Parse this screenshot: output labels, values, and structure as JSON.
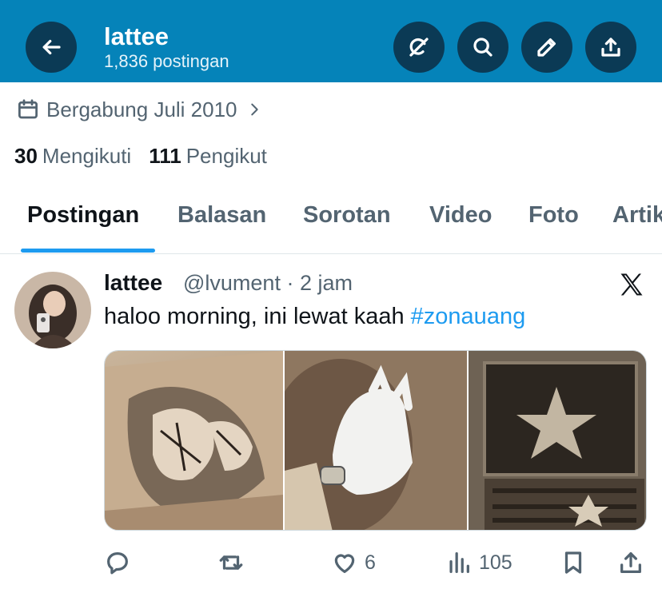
{
  "header": {
    "title": "lattee",
    "subtitle": "1,836 postingan",
    "color": "#0583b9",
    "buttons": [
      {
        "name": "back",
        "icon": "arrow-left-icon"
      },
      {
        "name": "grok",
        "icon": "grok-icon"
      },
      {
        "name": "search",
        "icon": "search-icon"
      },
      {
        "name": "compose",
        "icon": "pencil-icon"
      },
      {
        "name": "share",
        "icon": "share-icon"
      }
    ]
  },
  "profile": {
    "joined": "Bergabung Juli 2010",
    "following_count": "30",
    "following_label": "Mengikuti",
    "followers_count": "111",
    "followers_label": "Pengikut"
  },
  "tabs": [
    {
      "label": "Postingan",
      "active": true
    },
    {
      "label": "Balasan"
    },
    {
      "label": "Sorotan"
    },
    {
      "label": "Video"
    },
    {
      "label": "Foto"
    },
    {
      "label": "Artikel"
    }
  ],
  "tweet": {
    "name": "lattee",
    "handle_time": "@lvument · 2 jam",
    "text": "haloo morning, ini lewat kaah ",
    "hashtag": "#zonauang",
    "images": [
      "manga-drawing-photo",
      "white-glove-hand-photo",
      "star-box-photo"
    ],
    "actions": {
      "reply": "",
      "repost": "",
      "likes": "6",
      "views": "105"
    }
  },
  "colors": {
    "accent": "#1d9bf0",
    "muted": "#536471",
    "text": "#0f1419"
  }
}
